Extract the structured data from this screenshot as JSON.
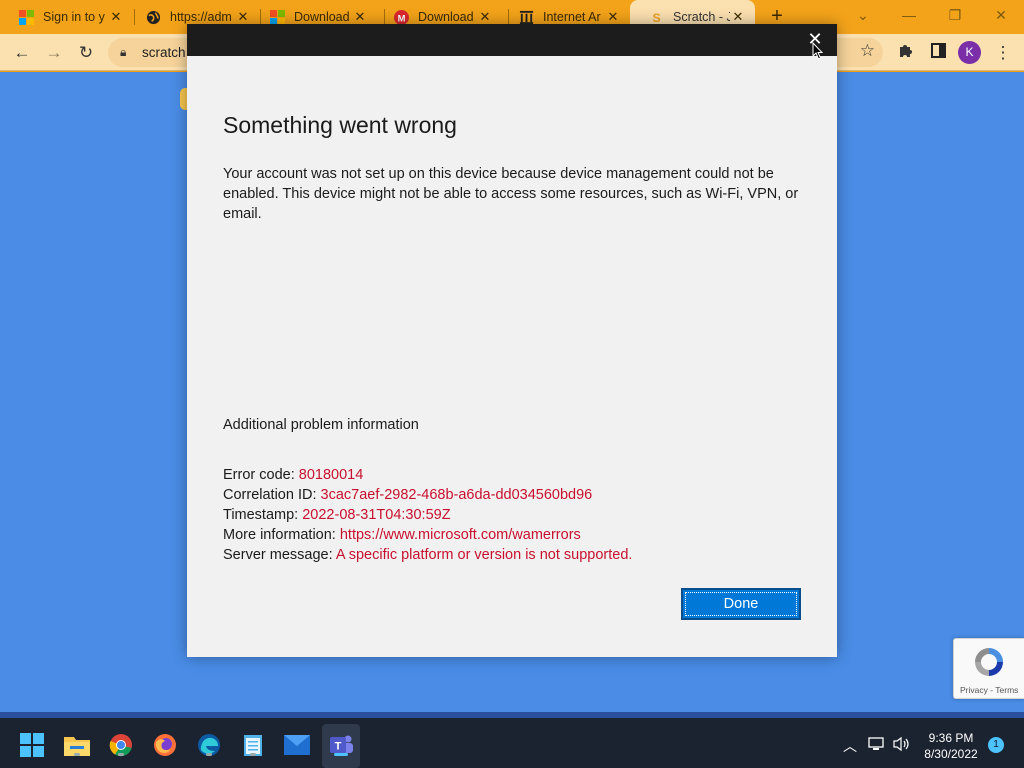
{
  "browser": {
    "tabs": [
      {
        "title": "Sign in to y",
        "icon": "microsoft-icon"
      },
      {
        "title": "https://adm",
        "icon": "globe-icon"
      },
      {
        "title": "Download",
        "icon": "microsoft-icon"
      },
      {
        "title": "Download",
        "icon": "mega-icon"
      },
      {
        "title": "Internet Ar",
        "icon": "archive-icon"
      },
      {
        "title": "Scratch - Jc",
        "icon": "scratch-icon",
        "active": true
      }
    ],
    "address": "scratch",
    "profile_initial": "K",
    "colors": {
      "tab_strip": "#f3a31a",
      "toolbar": "#fbe0b0",
      "page_bg": "#4a8ce6"
    }
  },
  "dialog": {
    "title": "Something went wrong",
    "message": "Your account was not set up on this device because device management could not be enabled. This device might not be able to access some resources, such as Wi-Fi, VPN, or email.",
    "additional_heading": "Additional problem information",
    "details": [
      {
        "label": "Error code: ",
        "value": "80180014"
      },
      {
        "label": "Correlation ID: ",
        "value": "3cac7aef-2982-468b-a6da-dd034560bd96"
      },
      {
        "label": "Timestamp: ",
        "value": "2022-08-31T04:30:59Z"
      },
      {
        "label": "More information: ",
        "value": "https://www.microsoft.com/wamerrors"
      },
      {
        "label": "Server message: ",
        "value": "A specific platform or version is not supported."
      }
    ],
    "done_label": "Done",
    "colors": {
      "value_text": "#c8102e",
      "button": "#0078d7",
      "titlebar": "#1c1c1c"
    }
  },
  "recaptcha": {
    "footer": "Privacy - Terms"
  },
  "taskbar": {
    "apps": [
      "start-icon",
      "file-explorer-icon",
      "chrome-icon",
      "firefox-icon",
      "edge-icon",
      "notepad-icon",
      "mail-icon",
      "teams-icon"
    ],
    "time": "9:36 PM",
    "date": "8/30/2022",
    "notifications": "1"
  }
}
